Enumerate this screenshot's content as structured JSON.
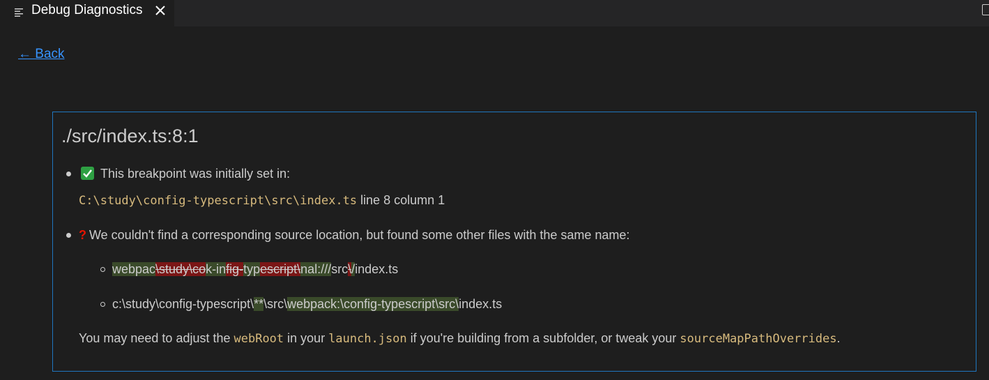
{
  "tab": {
    "title": "Debug Diagnostics"
  },
  "back_link": "← Back",
  "panel": {
    "title": "./src/index.ts:8:1",
    "item1": {
      "text": "This breakpoint was initially set in:",
      "path": "C:\\study\\config-typescript\\src\\index.ts",
      "location": " line 8 column 1"
    },
    "item2": {
      "text": "We couldn't find a corresponding source location, but found some other files with the same name:",
      "files": [
        {
          "segments": [
            {
              "text": "webpac",
              "kind": "ins"
            },
            {
              "text": "\\study\\co",
              "kind": "del"
            },
            {
              "text": "k-in",
              "kind": "ins"
            },
            {
              "text": "fig-",
              "kind": "del"
            },
            {
              "text": "typ",
              "kind": "ins"
            },
            {
              "text": "escript",
              "kind": "del"
            },
            {
              "text": "\\",
              "kind": "del"
            },
            {
              "text": "nal:///",
              "kind": "ins"
            },
            {
              "text": "src",
              "kind": "plain"
            },
            {
              "text": "\\",
              "kind": "del"
            },
            {
              "text": "/",
              "kind": "ins"
            },
            {
              "text": "index.ts",
              "kind": "plain"
            }
          ]
        },
        {
          "segments": [
            {
              "text": "c:\\study\\config-typescript\\",
              "kind": "plain"
            },
            {
              "text": "**",
              "kind": "ins"
            },
            {
              "text": "\\src\\",
              "kind": "plain"
            },
            {
              "text": "webpack:\\",
              "kind": "ins"
            },
            {
              "text": "config-typescript",
              "kind": "ins"
            },
            {
              "text": "\\src\\",
              "kind": "ins"
            },
            {
              "text": "index.ts",
              "kind": "plain"
            }
          ]
        }
      ]
    },
    "footer": {
      "pre": "You may need to adjust the ",
      "webroot": "webRoot",
      "mid1": " in your ",
      "launch": "launch.json",
      "mid2": " if you're building from a subfolder, or tweak your ",
      "overrides": "sourceMapPathOverrides",
      "post": "."
    }
  },
  "colors": {
    "accent_border": "#1f76bf",
    "link": "#3794ff",
    "code_text": "#d7ba7d",
    "diff_insert_bg": "#3a4a2a",
    "diff_delete_bg": "#7b1616"
  },
  "icons": [
    "preview-icon",
    "close-icon",
    "split-editor-icon",
    "check-mark-icon",
    "question-mark-icon"
  ]
}
